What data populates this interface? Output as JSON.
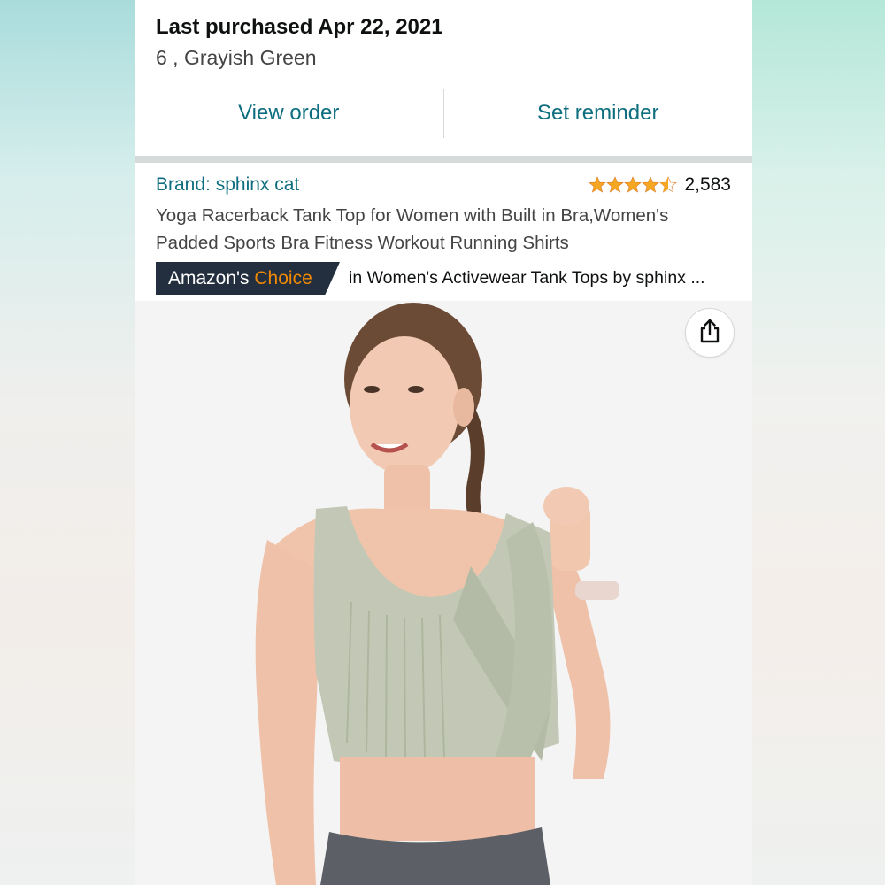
{
  "purchase": {
    "title": "Last purchased Apr 22, 2021",
    "variant": "6 , Grayish Green",
    "view_order_label": "View order",
    "set_reminder_label": "Set reminder"
  },
  "product": {
    "brand": "Brand: sphinx cat",
    "rating": 4.5,
    "rating_count": "2,583",
    "title": "Yoga Racerback Tank Top for Women with Built in Bra,Women's Padded Sports Bra Fitness Workout Running Shirts",
    "badge_prefix": "Amazon's ",
    "badge_highlight": "Choice",
    "choice_category": "in Women's Activewear Tank Tops by sphinx ..."
  },
  "icons": {
    "share": "share-icon",
    "star": "star-icon"
  },
  "colors": {
    "link": "#0e6e7f",
    "star": "#f5a623",
    "badge_bg": "#232f3e",
    "badge_accent": "#f08804",
    "garment": "#c2c8b5"
  }
}
